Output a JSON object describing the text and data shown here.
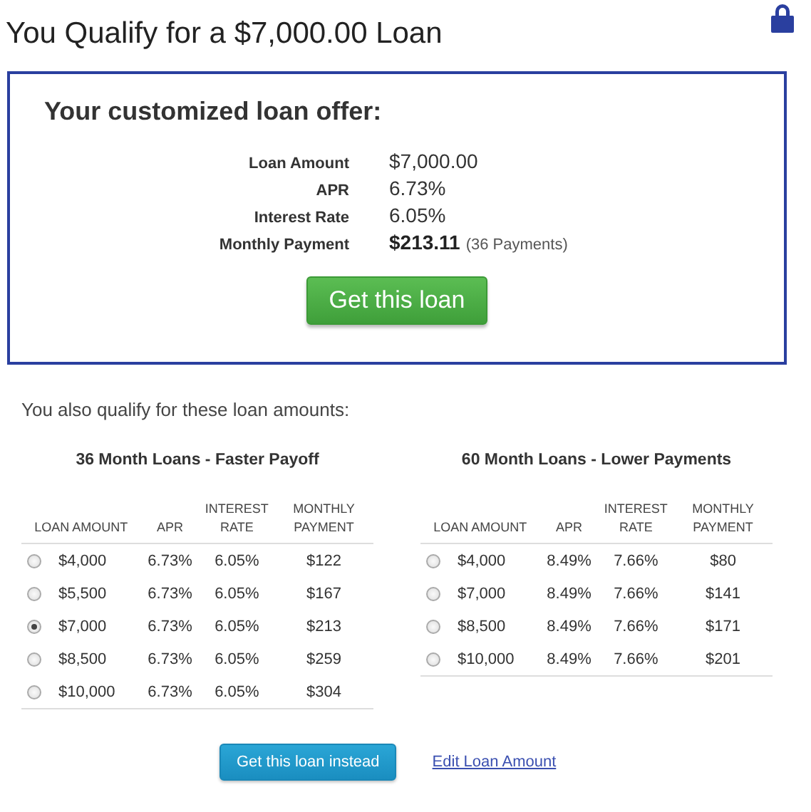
{
  "title": "You Qualify for a $7,000.00 Loan",
  "offer": {
    "heading": "Your customized loan offer:",
    "details": [
      {
        "label": "Loan Amount",
        "value": "$7,000.00"
      },
      {
        "label": "APR",
        "value": "6.73%"
      },
      {
        "label": "Interest Rate",
        "value": "6.05%"
      },
      {
        "label": "Monthly Payment",
        "value": "$213.11",
        "note": "(36 Payments)"
      }
    ],
    "button": "Get this loan"
  },
  "also_qualify": "You also qualify for these loan amounts:",
  "tables": [
    {
      "heading": "36 Month Loans - Faster Payoff",
      "columns": [
        "LOAN AMOUNT",
        "APR",
        "INTEREST RATE",
        "MONTHLY PAYMENT"
      ],
      "rows": [
        {
          "amount": "$4,000",
          "apr": "6.73%",
          "rate": "6.05%",
          "payment": "$122",
          "selected": false
        },
        {
          "amount": "$5,500",
          "apr": "6.73%",
          "rate": "6.05%",
          "payment": "$167",
          "selected": false
        },
        {
          "amount": "$7,000",
          "apr": "6.73%",
          "rate": "6.05%",
          "payment": "$213",
          "selected": true
        },
        {
          "amount": "$8,500",
          "apr": "6.73%",
          "rate": "6.05%",
          "payment": "$259",
          "selected": false
        },
        {
          "amount": "$10,000",
          "apr": "6.73%",
          "rate": "6.05%",
          "payment": "$304",
          "selected": false
        }
      ]
    },
    {
      "heading": "60 Month Loans - Lower Payments",
      "columns": [
        "LOAN AMOUNT",
        "APR",
        "INTEREST RATE",
        "MONTHLY PAYMENT"
      ],
      "rows": [
        {
          "amount": "$4,000",
          "apr": "8.49%",
          "rate": "7.66%",
          "payment": "$80",
          "selected": false
        },
        {
          "amount": "$7,000",
          "apr": "8.49%",
          "rate": "7.66%",
          "payment": "$141",
          "selected": false
        },
        {
          "amount": "$8,500",
          "apr": "8.49%",
          "rate": "7.66%",
          "payment": "$171",
          "selected": false
        },
        {
          "amount": "$10,000",
          "apr": "8.49%",
          "rate": "7.66%",
          "payment": "$201",
          "selected": false
        }
      ]
    }
  ],
  "actions": {
    "button": "Get this loan instead",
    "link": "Edit Loan Amount"
  }
}
